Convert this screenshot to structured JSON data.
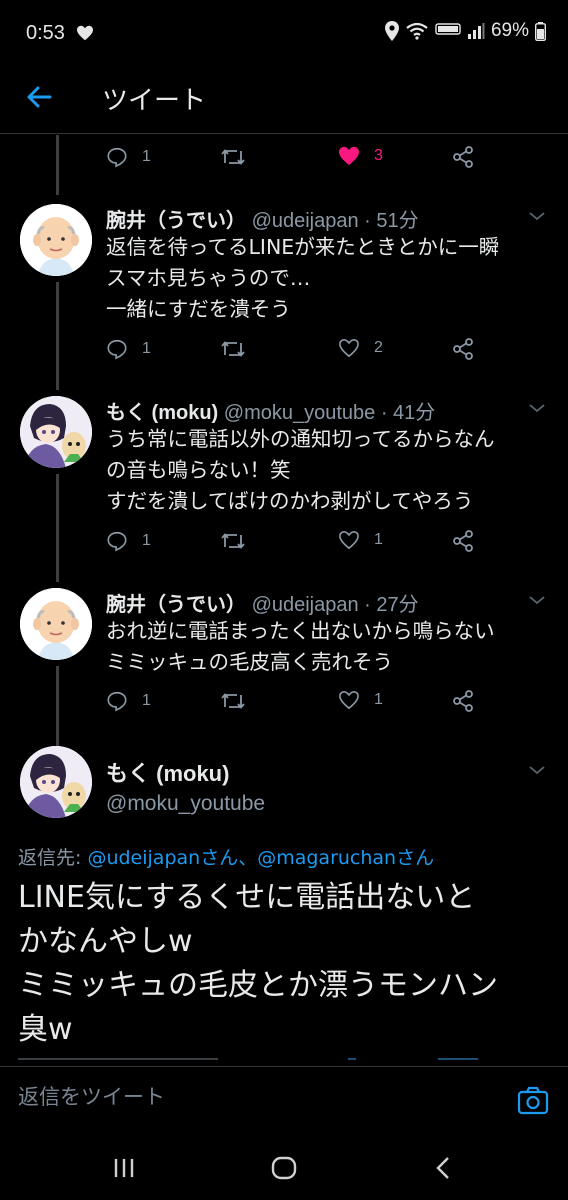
{
  "status_bar": {
    "time": "0:53",
    "battery": "69%"
  },
  "header": {
    "title": "ツイート"
  },
  "top_actions": {
    "reply_count": "1",
    "like_count": "3"
  },
  "replies": [
    {
      "name": "腕井（うでい）",
      "handle": "@udeijapan · 51分",
      "lines": [
        "返信を待ってるLINEが来たときとかに一瞬",
        "スマホ見ちゃうので…",
        "一緒にすだを潰そう"
      ],
      "reply_count": "1",
      "like_count": "2"
    },
    {
      "name": "もく (moku)",
      "handle": "@moku_youtube · 41分",
      "lines": [
        "うち常に電話以外の通知切ってるからなん",
        "の音も鳴らない！笑",
        "すだを潰してばけのかわ剥がしてやろう"
      ],
      "reply_count": "1",
      "like_count": "1"
    },
    {
      "name": "腕井（うでい）",
      "handle": "@udeijapan · 27分",
      "lines": [
        "おれ逆に電話まったく出ないから鳴らない",
        "ミミッキュの毛皮高く売れそう"
      ],
      "reply_count": "1",
      "like_count": "1"
    }
  ],
  "main_tweet": {
    "name": "もく (moku)",
    "handle": "@moku_youtube",
    "reply_prefix": "返信先: ",
    "reply_user1": "@udeijapanさん",
    "reply_sep": "、",
    "reply_user2": "@magaruchanさん",
    "lines": [
      "LINE気にするくせに電話出ないと",
      "かなんやしw",
      "ミミッキュの毛皮とか漂うモンハン",
      "臭w"
    ]
  },
  "compose": {
    "placeholder": "返信をツイート"
  },
  "colors": {
    "accent": "#1d9bf0",
    "like": "#f91880",
    "background": "#000000",
    "secondary_text": "#8b98a5"
  }
}
